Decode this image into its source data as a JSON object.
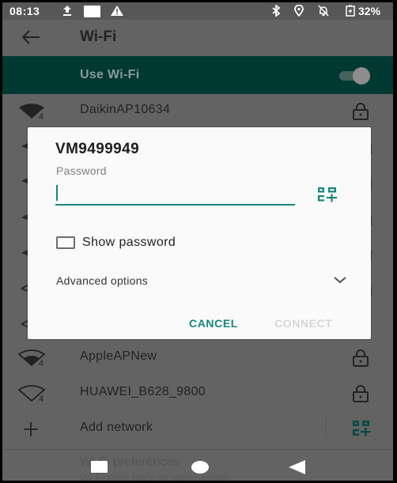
{
  "status_bar": {
    "time": "08:13",
    "battery_percent": "32%",
    "icons": [
      "upload-icon",
      "notification-square-icon",
      "warning-icon",
      "bluetooth-icon",
      "location-icon",
      "notifications-off-icon",
      "battery-charging-icon"
    ]
  },
  "app_bar": {
    "back_icon": "arrow-back-icon",
    "title": "Wi-Fi"
  },
  "use_wifi": {
    "label": "Use Wi-Fi",
    "enabled": true
  },
  "networks": [
    {
      "ssid": "DaikinAP10634",
      "signal_icon": "wifi-signal-full-icon",
      "secured": true
    },
    {
      "ssid": "AppleAPNew",
      "signal_icon": "wifi-signal-medium-icon",
      "secured": true
    },
    {
      "ssid": "HUAWEI_B628_9800",
      "signal_icon": "wifi-signal-low-icon",
      "secured": true
    }
  ],
  "add_network": {
    "label": "Add network",
    "icon": "plus-icon",
    "qr_icon": "qr-code-scan-icon"
  },
  "preferences": {
    "title": "Wi-Fi preferences",
    "subtitle": "Wi-Fi turns back on automatically"
  },
  "dialog": {
    "title": "VM9499949",
    "password_label": "Password",
    "password_value": "",
    "qr_icon": "qr-code-scan-icon",
    "show_password_label": "Show password",
    "show_password_checked": false,
    "advanced_options_label": "Advanced options",
    "cancel_label": "CANCEL",
    "connect_label": "CONNECT",
    "connect_enabled": false
  },
  "colors": {
    "accent": "#14877a",
    "use_wifi_bar": "#003832",
    "scrim_background": "#636363",
    "dialog_background": "#fafafa",
    "disabled_text": "#d6d6d6"
  },
  "nav_bar": {
    "recent_icon": "recent-apps-icon",
    "home_icon": "home-icon",
    "back_icon": "back-triangle-icon"
  }
}
